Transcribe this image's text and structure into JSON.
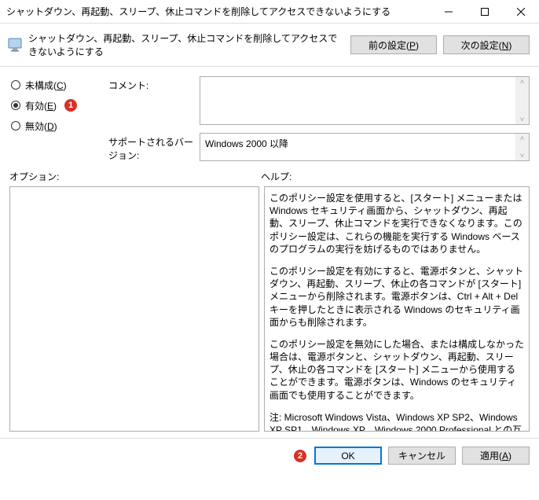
{
  "window": {
    "title": "シャットダウン、再起動、スリープ、休止コマンドを削除してアクセスできないようにする"
  },
  "toolbar": {
    "label": "シャットダウン、再起動、スリープ、休止コマンドを削除してアクセスできないようにする",
    "prev": "前の設定(P)",
    "next": "次の設定(N)"
  },
  "radios": {
    "not_configured": "未構成(C)",
    "enabled": "有効(E)",
    "disabled": "無効(D)",
    "selected": "enabled"
  },
  "fields": {
    "comment_label": "コメント:",
    "supported_label": "サポートされるバージョン:",
    "supported_value": "Windows 2000 以降"
  },
  "sections": {
    "options_label": "オプション:",
    "help_label": "ヘルプ:"
  },
  "help": {
    "p1": "このポリシー設定を使用すると、[スタート] メニューまたは Windows セキュリティ画面から、シャットダウン、再起動、スリープ、休止コマンドを実行できなくなります。このポリシー設定は、これらの機能を実行する Windows ベースのプログラムの実行を妨げるものではありません。",
    "p2": "このポリシー設定を有効にすると、電源ボタンと、シャットダウン、再起動、スリープ、休止の各コマンドが [スタート] メニューから削除されます。電源ボタンは、Ctrl + Alt + Del キーを押したときに表示される Windows のセキュリティ画面からも削除されます。",
    "p3": "このポリシー設定を無効にした場合、または構成しなかった場合は、電源ボタンと、シャットダウン、再起動、スリープ、休止の各コマンドを [スタート] メニューから使用することができます。電源ボタンは、Windows のセキュリティ画面でも使用することができます。",
    "p4": "注: Microsoft Windows Vista、Windows XP SP2、Windows XP SP1、Windows XP、Windows 2000 Professional との互換性が保証されたサード パーティのプログラムは、このポリシー設定をサポートしている必要があります。"
  },
  "buttons": {
    "ok": "OK",
    "cancel": "キャンセル",
    "apply": "適用(A)"
  },
  "annotations": {
    "one": "1",
    "two": "2"
  }
}
